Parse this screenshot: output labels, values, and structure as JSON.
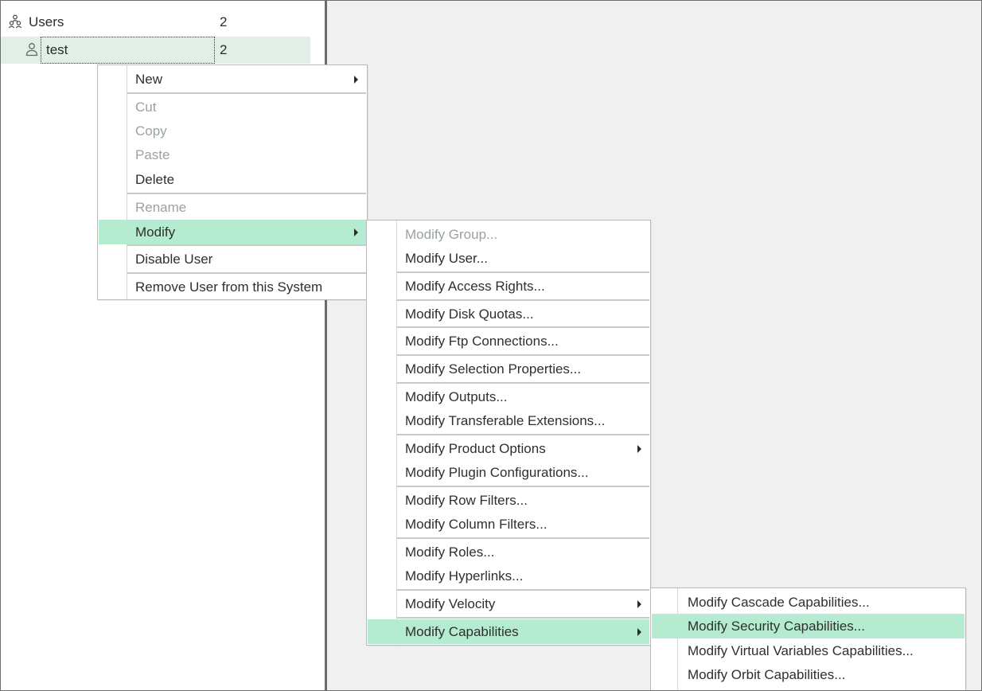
{
  "tree": {
    "root": {
      "label": "Users",
      "count": "2"
    },
    "child": {
      "label": "test",
      "count": "2"
    }
  },
  "context_menu": {
    "items": [
      {
        "label": "New",
        "disabled": false,
        "submenu": true
      },
      {
        "label": "Cut",
        "disabled": true
      },
      {
        "label": "Copy",
        "disabled": true
      },
      {
        "label": "Paste",
        "disabled": true
      },
      {
        "label": "Delete",
        "disabled": false
      },
      {
        "label": "Rename",
        "disabled": true
      },
      {
        "label": "Modify",
        "disabled": false,
        "submenu": true,
        "highlighted": true
      },
      {
        "label": "Disable User",
        "disabled": false
      },
      {
        "label": "Remove User from this System",
        "disabled": false
      }
    ]
  },
  "modify_menu": {
    "items": [
      {
        "label": "Modify Group...",
        "disabled": true
      },
      {
        "label": "Modify User...",
        "disabled": false
      },
      {
        "label": "Modify Access Rights...",
        "disabled": false
      },
      {
        "label": "Modify Disk Quotas...",
        "disabled": false
      },
      {
        "label": "Modify Ftp Connections...",
        "disabled": false
      },
      {
        "label": "Modify Selection Properties...",
        "disabled": false
      },
      {
        "label": "Modify Outputs...",
        "disabled": false
      },
      {
        "label": "Modify Transferable Extensions...",
        "disabled": false
      },
      {
        "label": "Modify Product Options",
        "disabled": false,
        "submenu": true
      },
      {
        "label": "Modify Plugin Configurations...",
        "disabled": false
      },
      {
        "label": "Modify Row Filters...",
        "disabled": false
      },
      {
        "label": "Modify Column Filters...",
        "disabled": false
      },
      {
        "label": "Modify Roles...",
        "disabled": false
      },
      {
        "label": "Modify Hyperlinks...",
        "disabled": false
      },
      {
        "label": "Modify Velocity",
        "disabled": false,
        "submenu": true
      },
      {
        "label": "Modify Capabilities",
        "disabled": false,
        "submenu": true,
        "highlighted": true
      }
    ]
  },
  "capabilities_menu": {
    "items": [
      {
        "label": "Modify Cascade Capabilities...",
        "disabled": false
      },
      {
        "label": "Modify Security Capabilities...",
        "disabled": false,
        "highlighted": true
      },
      {
        "label": "Modify Virtual Variables Capabilities...",
        "disabled": false
      },
      {
        "label": "Modify Orbit Capabilities...",
        "disabled": false
      }
    ]
  },
  "colors": {
    "highlight": "#b5ebd1",
    "selected_row": "#e1efe6",
    "disabled_text": "#9aa2a3",
    "right_pane_bg": "#f0f0f0"
  },
  "icons": {
    "root": "user-group-icon",
    "child": "user-icon",
    "submenu": "submenu-arrow-icon"
  }
}
